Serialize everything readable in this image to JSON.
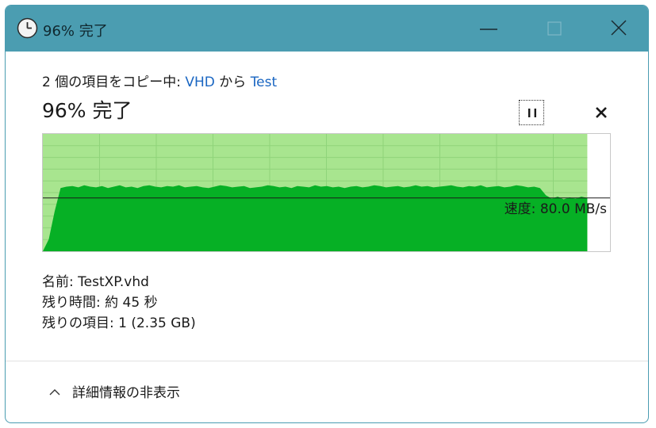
{
  "window": {
    "title": "96% 完了",
    "icon": "clock-icon",
    "controls": {
      "minimize_icon": "minimize-icon",
      "maximize_icon": "maximize-icon",
      "close_icon": "close-icon"
    }
  },
  "copy": {
    "count_prefix": "2 個の項目をコピー中: ",
    "source": "VHD",
    "from_word": " から ",
    "destination": "Test",
    "percent_title": "96% 完了",
    "progress_percent": 96,
    "pause_icon": "pause-icon",
    "cancel_icon": "cancel-icon"
  },
  "chart_data": {
    "type": "area",
    "speed_label": "速度: 80.0 MB/s",
    "current_speed_mbps": 80.0,
    "progress_fraction": 0.96,
    "series": [
      {
        "values": [
          0,
          18,
          60,
          95,
          97,
          98,
          96,
          99,
          97,
          96,
          98,
          95,
          97,
          99,
          96,
          97,
          95,
          98,
          99,
          97,
          96,
          98,
          97,
          99,
          96,
          97,
          98,
          96,
          95,
          97,
          99,
          98,
          96,
          97,
          98,
          95,
          96,
          97,
          99,
          98,
          96,
          97,
          95,
          98,
          97,
          96,
          99,
          97,
          98,
          96,
          97,
          95,
          97,
          98,
          96,
          97,
          99,
          98,
          96,
          97,
          98,
          96,
          97,
          99,
          97,
          98,
          96,
          97,
          98,
          99,
          97,
          96,
          98,
          97,
          99,
          96,
          97,
          98,
          96,
          97,
          99,
          98,
          96,
          97,
          95,
          84,
          79,
          82,
          78,
          81,
          79,
          82,
          80
        ]
      }
    ],
    "colors": {
      "progress_fill": "#a8e58f",
      "throughput_fill": "#06b025",
      "grid": "#8fd47a",
      "speed_line": "#1a1a1a"
    }
  },
  "details": {
    "name": "名前: TestXP.vhd",
    "time_remaining": "残り時間: 約 45 秒",
    "items_remaining": "残りの項目: 1 (2.35 GB)"
  },
  "footer": {
    "toggle_label": "詳細情報の非表示",
    "toggle_icon": "chevron-up-icon"
  }
}
